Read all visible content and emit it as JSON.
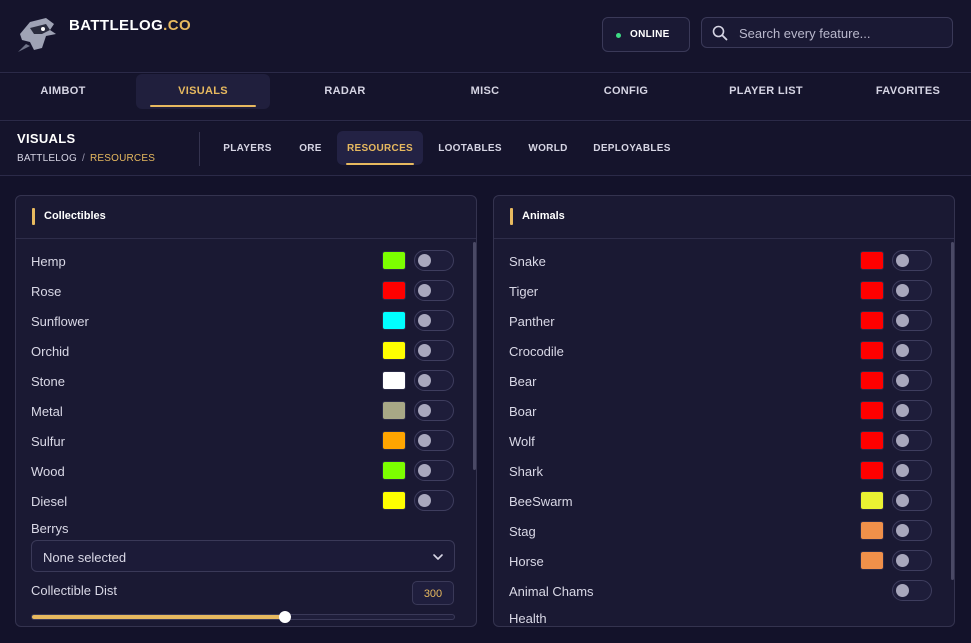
{
  "brand": {
    "name": "BATTLELOG",
    "suffix": ".CO"
  },
  "status": {
    "label": "ONLINE",
    "color": "#3ddc84"
  },
  "search": {
    "placeholder": "Search every feature..."
  },
  "colors": {
    "accent": "#e7b95f",
    "background": "#13122a",
    "panel": "#1a1933"
  },
  "main_tabs": [
    {
      "label": "AIMBOT",
      "active": false
    },
    {
      "label": "VISUALS",
      "active": true
    },
    {
      "label": "RADAR",
      "active": false
    },
    {
      "label": "MISC",
      "active": false
    },
    {
      "label": "CONFIG",
      "active": false
    },
    {
      "label": "PLAYER LIST",
      "active": false
    },
    {
      "label": "FAVORITES",
      "active": false
    }
  ],
  "page": {
    "title": "VISUALS",
    "breadcrumb": {
      "root": "BATTLELOG",
      "separator": "/",
      "current": "RESOURCES"
    }
  },
  "sub_tabs": [
    {
      "label": "PLAYERS",
      "active": false
    },
    {
      "label": "ORE",
      "active": false
    },
    {
      "label": "RESOURCES",
      "active": true
    },
    {
      "label": "LOOTABLES",
      "active": false
    },
    {
      "label": "WORLD",
      "active": false
    },
    {
      "label": "DEPLOYABLES",
      "active": false
    }
  ],
  "collectibles": {
    "title": "Collectibles",
    "items": [
      {
        "label": "Hemp",
        "color": "#7cff00",
        "enabled": false
      },
      {
        "label": "Rose",
        "color": "#ff0000",
        "enabled": false
      },
      {
        "label": "Sunflower",
        "color": "#00ffff",
        "enabled": false
      },
      {
        "label": "Orchid",
        "color": "#ffff00",
        "enabled": false
      },
      {
        "label": "Stone",
        "color": "#ffffff",
        "enabled": false
      },
      {
        "label": "Metal",
        "color": "#a8a886",
        "enabled": false
      },
      {
        "label": "Sulfur",
        "color": "#ffa500",
        "enabled": false
      },
      {
        "label": "Wood",
        "color": "#7cff00",
        "enabled": false
      },
      {
        "label": "Diesel",
        "color": "#ffff00",
        "enabled": false
      }
    ],
    "berrys": {
      "label": "Berrys",
      "value": "None selected"
    },
    "distance": {
      "label": "Collectible Dist",
      "value": "300",
      "fill_fraction": 0.6
    }
  },
  "animals": {
    "title": "Animals",
    "items": [
      {
        "label": "Snake",
        "color": "#ff0000",
        "enabled": false
      },
      {
        "label": "Tiger",
        "color": "#ff0000",
        "enabled": false
      },
      {
        "label": "Panther",
        "color": "#ff0000",
        "enabled": false
      },
      {
        "label": "Crocodile",
        "color": "#ff0000",
        "enabled": false
      },
      {
        "label": "Bear",
        "color": "#ff0000",
        "enabled": false
      },
      {
        "label": "Boar",
        "color": "#ff0000",
        "enabled": false
      },
      {
        "label": "Wolf",
        "color": "#ff0000",
        "enabled": false
      },
      {
        "label": "Shark",
        "color": "#ff0000",
        "enabled": false
      },
      {
        "label": "BeeSwarm",
        "color": "#eaf232",
        "enabled": false
      },
      {
        "label": "Stag",
        "color": "#f0904a",
        "enabled": false
      },
      {
        "label": "Horse",
        "color": "#f0904a",
        "enabled": false
      }
    ],
    "chams": {
      "label": "Animal Chams",
      "enabled": false
    },
    "health": {
      "label": "Health"
    }
  }
}
